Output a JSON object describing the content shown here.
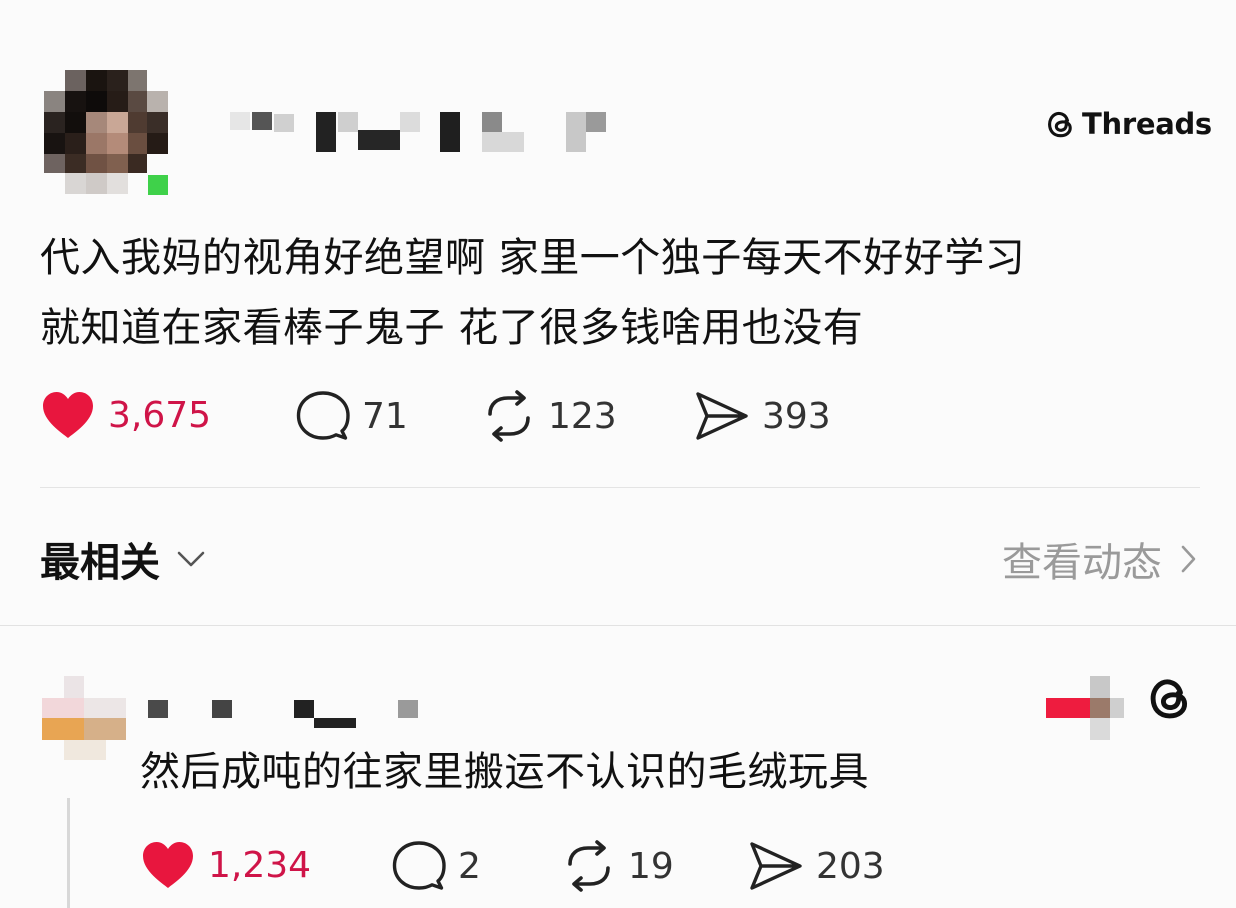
{
  "post": {
    "badge_label": "Threads",
    "badge_icon": "threads-logo-icon",
    "text_line1": "代入我妈的视角好绝望啊 家里一个独子每天不好好学习",
    "text_line2": "就知道在家看棒子鬼子 花了很多钱啥用也没有",
    "stats": {
      "likes": "3,675",
      "comments": "71",
      "reposts": "123",
      "shares": "393"
    }
  },
  "sort": {
    "label": "最相关"
  },
  "activity_link": {
    "label": "查看动态"
  },
  "reply": {
    "text": "然后成吨的往家里搬运不认识的毛绒玩具",
    "stats": {
      "likes": "1,234",
      "comments": "2",
      "reposts": "19",
      "shares": "203"
    }
  },
  "colors": {
    "like_red": "#e8163e",
    "like_count": "#cf1448",
    "online_green": "#3fd14a",
    "muted_gray": "#9a9a9a"
  }
}
